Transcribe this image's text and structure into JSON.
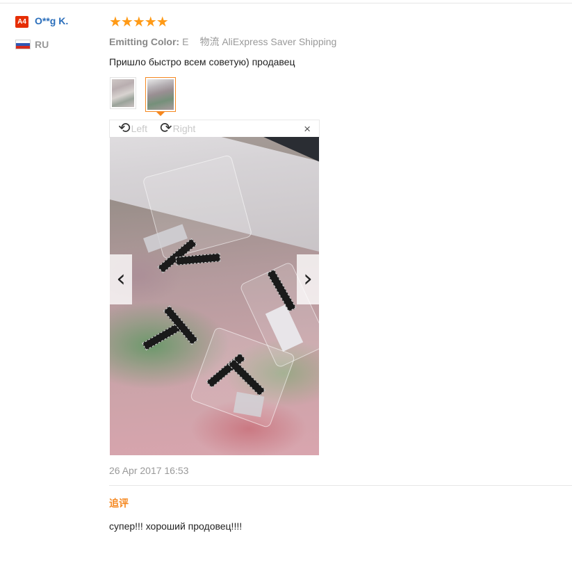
{
  "user": {
    "level_badge": "A4",
    "name": "O**g K.",
    "country": "RU"
  },
  "review": {
    "rating": 5,
    "stars_text": "★★★★★",
    "sku_label": "Emitting Color:",
    "sku_value": "E",
    "logistics_label": "物流",
    "logistics_value": "AliExpress Saver Shipping",
    "text": "Пришло быстро всем советую) продавец",
    "thumbnail_count": 2,
    "selected_thumbnail": 2
  },
  "viewer": {
    "rotate_left_label": "Left",
    "rotate_right_label": "Right",
    "close_glyph": "×",
    "prev_glyph": "‹",
    "next_glyph": "›",
    "rotate_left_glyph": "⟲",
    "rotate_right_glyph": "⟳"
  },
  "date": "26 Apr 2017 16:53",
  "followup": {
    "label": "追评",
    "text": "супер!!! хороший продовец!!!!"
  },
  "colors": {
    "star": "#ff9a16",
    "username": "#2a6ebb",
    "badge": "#e62e04",
    "accent_orange": "#f5871f"
  }
}
